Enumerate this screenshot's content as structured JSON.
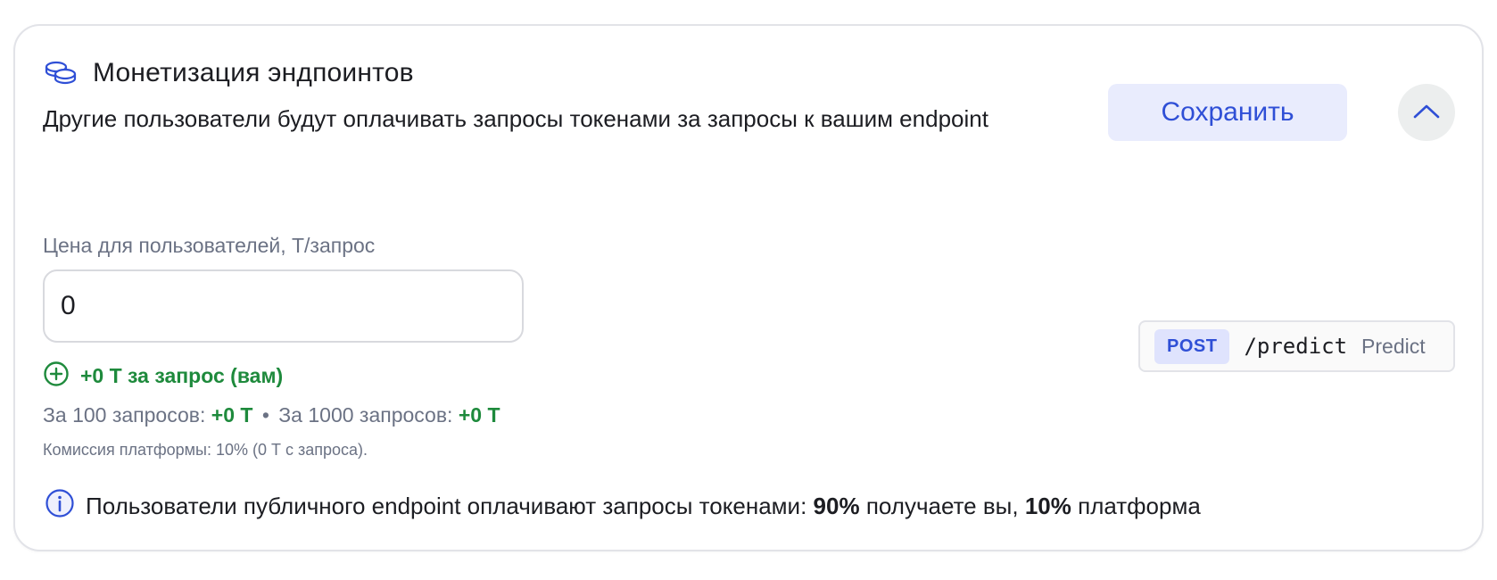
{
  "header": {
    "icon": "coins-icon",
    "title": "Монетизация эндпоинтов",
    "description": "Другие пользователи будут оплачивать запросы токенами за запросы к вашим endpoint",
    "save_label": "Сохранить",
    "collapse_icon": "chevron-up-icon"
  },
  "pricing": {
    "label": "Цена для пользователей, Т/запрос",
    "value": "0",
    "earning_icon": "plus-circle-icon",
    "earning_text": "+0 Т за запрос (вам)",
    "per100_label": "За 100 запросов:",
    "per100_value": "+0 Т",
    "separator": "•",
    "per1000_label": "За 1000 запросов:",
    "per1000_value": "+0 Т",
    "commission": "Комиссия платформы: 10% (0 Т с запроса)."
  },
  "endpoint": {
    "method": "POST",
    "path": "/predict",
    "name": "Predict"
  },
  "info": {
    "icon": "info-icon",
    "text_start": "Пользователи публичного endpoint оплачивают запросы токенами:",
    "you_share": "90%",
    "you_text": "получаете вы,",
    "platform_share": "10%",
    "platform_text": "платформа"
  },
  "colors": {
    "accent": "#2f4fd6",
    "accent_bg": "#e9ecfd",
    "positive": "#1e8a3c",
    "muted": "#6b7284"
  }
}
